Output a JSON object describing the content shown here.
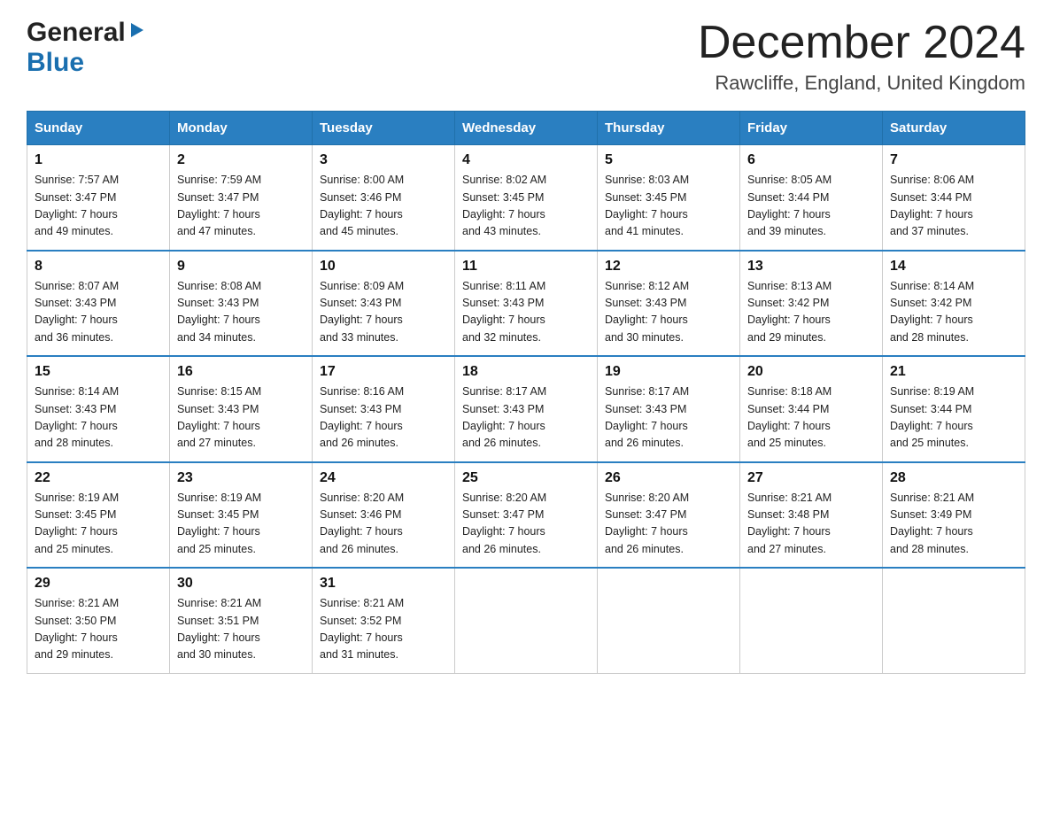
{
  "header": {
    "logo_general": "General",
    "logo_blue": "Blue",
    "month_title": "December 2024",
    "location": "Rawcliffe, England, United Kingdom"
  },
  "columns": [
    "Sunday",
    "Monday",
    "Tuesday",
    "Wednesday",
    "Thursday",
    "Friday",
    "Saturday"
  ],
  "weeks": [
    [
      {
        "day": "1",
        "sunrise": "7:57 AM",
        "sunset": "3:47 PM",
        "daylight": "7 hours and 49 minutes."
      },
      {
        "day": "2",
        "sunrise": "7:59 AM",
        "sunset": "3:47 PM",
        "daylight": "7 hours and 47 minutes."
      },
      {
        "day": "3",
        "sunrise": "8:00 AM",
        "sunset": "3:46 PM",
        "daylight": "7 hours and 45 minutes."
      },
      {
        "day": "4",
        "sunrise": "8:02 AM",
        "sunset": "3:45 PM",
        "daylight": "7 hours and 43 minutes."
      },
      {
        "day": "5",
        "sunrise": "8:03 AM",
        "sunset": "3:45 PM",
        "daylight": "7 hours and 41 minutes."
      },
      {
        "day": "6",
        "sunrise": "8:05 AM",
        "sunset": "3:44 PM",
        "daylight": "7 hours and 39 minutes."
      },
      {
        "day": "7",
        "sunrise": "8:06 AM",
        "sunset": "3:44 PM",
        "daylight": "7 hours and 37 minutes."
      }
    ],
    [
      {
        "day": "8",
        "sunrise": "8:07 AM",
        "sunset": "3:43 PM",
        "daylight": "7 hours and 36 minutes."
      },
      {
        "day": "9",
        "sunrise": "8:08 AM",
        "sunset": "3:43 PM",
        "daylight": "7 hours and 34 minutes."
      },
      {
        "day": "10",
        "sunrise": "8:09 AM",
        "sunset": "3:43 PM",
        "daylight": "7 hours and 33 minutes."
      },
      {
        "day": "11",
        "sunrise": "8:11 AM",
        "sunset": "3:43 PM",
        "daylight": "7 hours and 32 minutes."
      },
      {
        "day": "12",
        "sunrise": "8:12 AM",
        "sunset": "3:43 PM",
        "daylight": "7 hours and 30 minutes."
      },
      {
        "day": "13",
        "sunrise": "8:13 AM",
        "sunset": "3:42 PM",
        "daylight": "7 hours and 29 minutes."
      },
      {
        "day": "14",
        "sunrise": "8:14 AM",
        "sunset": "3:42 PM",
        "daylight": "7 hours and 28 minutes."
      }
    ],
    [
      {
        "day": "15",
        "sunrise": "8:14 AM",
        "sunset": "3:43 PM",
        "daylight": "7 hours and 28 minutes."
      },
      {
        "day": "16",
        "sunrise": "8:15 AM",
        "sunset": "3:43 PM",
        "daylight": "7 hours and 27 minutes."
      },
      {
        "day": "17",
        "sunrise": "8:16 AM",
        "sunset": "3:43 PM",
        "daylight": "7 hours and 26 minutes."
      },
      {
        "day": "18",
        "sunrise": "8:17 AM",
        "sunset": "3:43 PM",
        "daylight": "7 hours and 26 minutes."
      },
      {
        "day": "19",
        "sunrise": "8:17 AM",
        "sunset": "3:43 PM",
        "daylight": "7 hours and 26 minutes."
      },
      {
        "day": "20",
        "sunrise": "8:18 AM",
        "sunset": "3:44 PM",
        "daylight": "7 hours and 25 minutes."
      },
      {
        "day": "21",
        "sunrise": "8:19 AM",
        "sunset": "3:44 PM",
        "daylight": "7 hours and 25 minutes."
      }
    ],
    [
      {
        "day": "22",
        "sunrise": "8:19 AM",
        "sunset": "3:45 PM",
        "daylight": "7 hours and 25 minutes."
      },
      {
        "day": "23",
        "sunrise": "8:19 AM",
        "sunset": "3:45 PM",
        "daylight": "7 hours and 25 minutes."
      },
      {
        "day": "24",
        "sunrise": "8:20 AM",
        "sunset": "3:46 PM",
        "daylight": "7 hours and 26 minutes."
      },
      {
        "day": "25",
        "sunrise": "8:20 AM",
        "sunset": "3:47 PM",
        "daylight": "7 hours and 26 minutes."
      },
      {
        "day": "26",
        "sunrise": "8:20 AM",
        "sunset": "3:47 PM",
        "daylight": "7 hours and 26 minutes."
      },
      {
        "day": "27",
        "sunrise": "8:21 AM",
        "sunset": "3:48 PM",
        "daylight": "7 hours and 27 minutes."
      },
      {
        "day": "28",
        "sunrise": "8:21 AM",
        "sunset": "3:49 PM",
        "daylight": "7 hours and 28 minutes."
      }
    ],
    [
      {
        "day": "29",
        "sunrise": "8:21 AM",
        "sunset": "3:50 PM",
        "daylight": "7 hours and 29 minutes."
      },
      {
        "day": "30",
        "sunrise": "8:21 AM",
        "sunset": "3:51 PM",
        "daylight": "7 hours and 30 minutes."
      },
      {
        "day": "31",
        "sunrise": "8:21 AM",
        "sunset": "3:52 PM",
        "daylight": "7 hours and 31 minutes."
      },
      null,
      null,
      null,
      null
    ]
  ],
  "labels": {
    "sunrise": "Sunrise:",
    "sunset": "Sunset:",
    "daylight": "Daylight:"
  }
}
